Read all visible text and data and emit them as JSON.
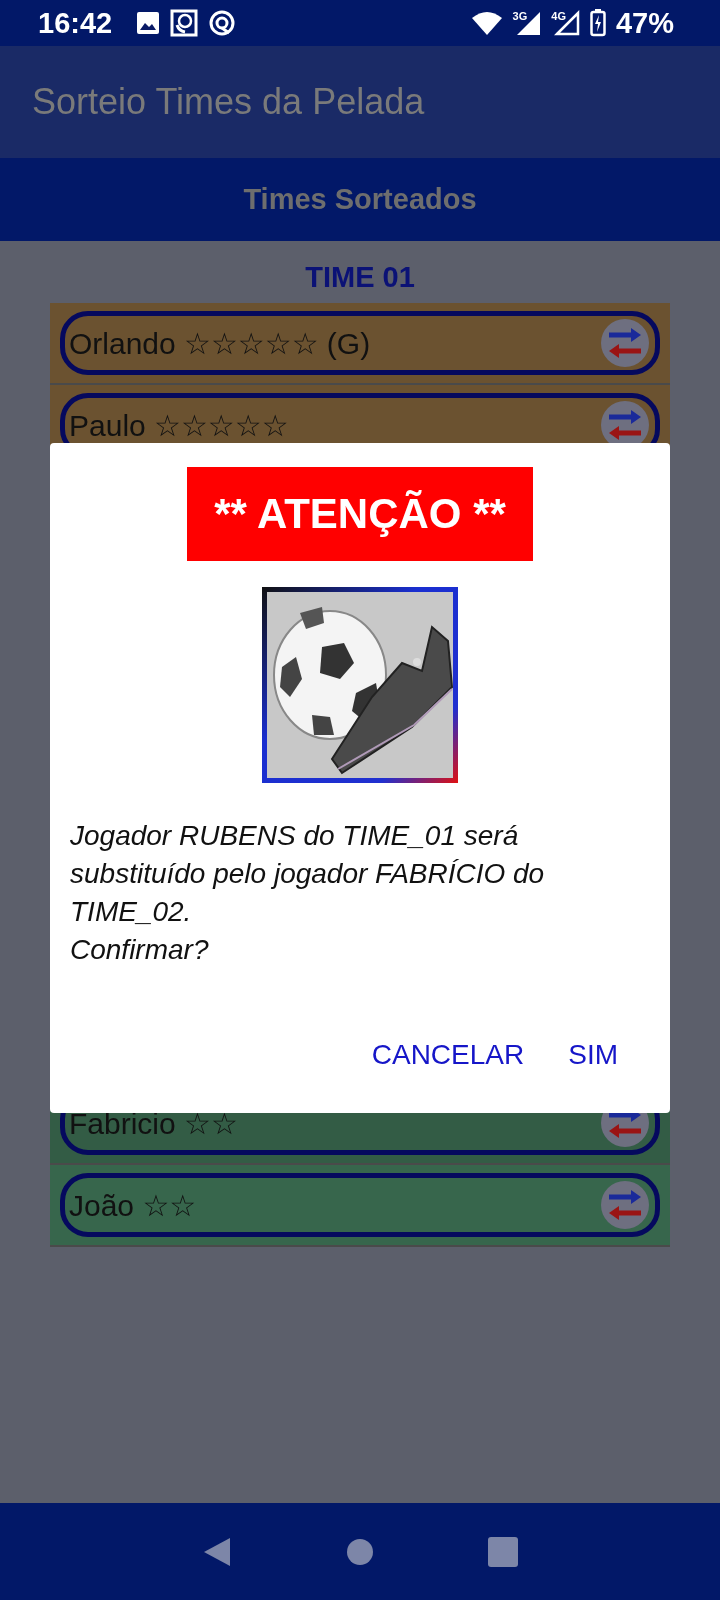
{
  "status_bar": {
    "time": "16:42",
    "network_1": "3G",
    "network_2": "4G",
    "battery": "47%"
  },
  "app_bar": {
    "title": "Sorteio Times da Pelada"
  },
  "tab_bar": {
    "title": "Times Sorteados"
  },
  "team": {
    "title": "TIME 01"
  },
  "players_above_dialog": [
    {
      "name": "Orlando ☆☆☆☆☆ (G)",
      "color": "#6b5230"
    },
    {
      "name": "Paulo ☆☆☆☆☆",
      "color": "#6b5230"
    }
  ],
  "players_below_dialog": [
    {
      "name": "Fabricio ☆☆",
      "color": "#335c45"
    },
    {
      "name": "João ☆☆",
      "color": "#37664c"
    }
  ],
  "dialog": {
    "title": "** ATENÇÃO **",
    "message": [
      "Jogador RUBENS do TIME_01 será substituído pelo jogador FABRÍCIO do TIME_02.",
      "Confirmar?"
    ],
    "buttons": [
      "CANCELAR",
      "SIM"
    ]
  }
}
